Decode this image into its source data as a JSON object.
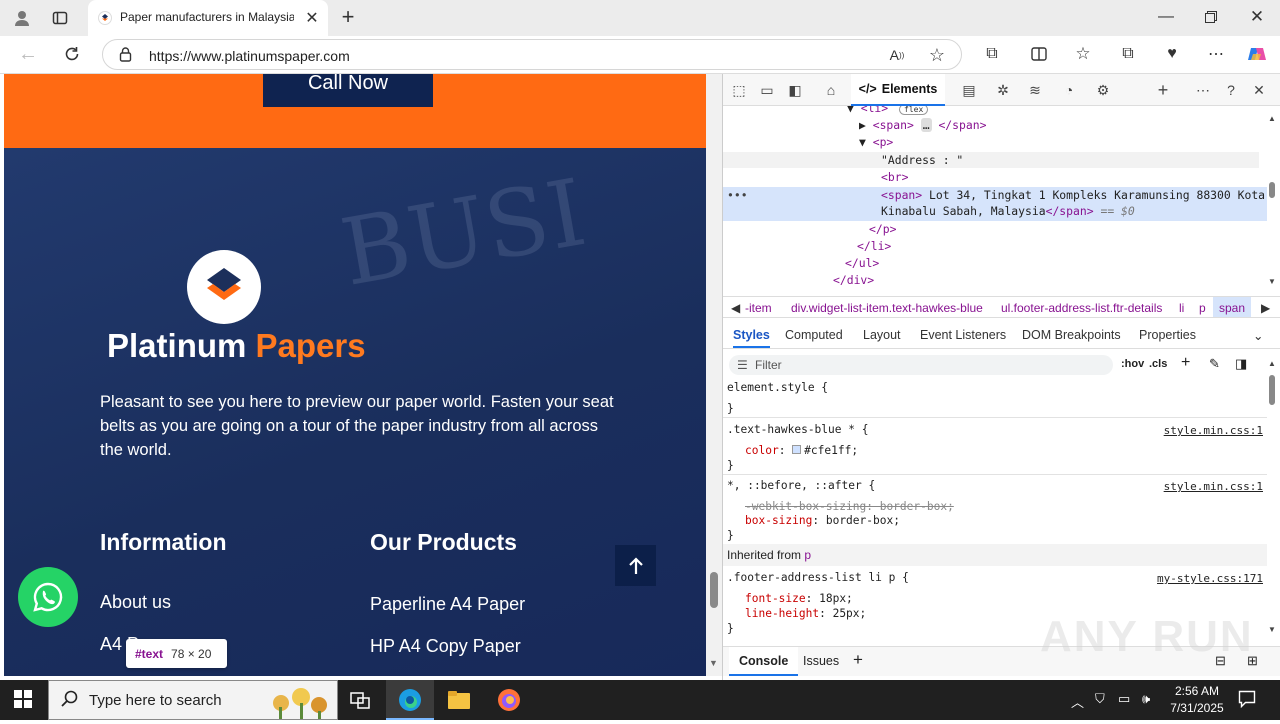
{
  "browser": {
    "tab_title": "Paper manufacturers in Malaysia,",
    "url": "https://www.platinumspaper.com"
  },
  "page": {
    "call_button": "Call Now",
    "brand_part1": "Platinum",
    "brand_part2": "Papers",
    "tagline": "Pleasant to see you here to preview our paper world. Fasten your seat belts as you are going on a tour of the paper industry from all across the world.",
    "info_heading": "Information",
    "info_links": [
      "About us",
      "A4 P"
    ],
    "products_heading": "Our Products",
    "product_links": [
      "Paperline A4 Paper",
      "HP A4 Copy Paper"
    ],
    "newspaper_word": "BUSI",
    "tooltip_node": "#text",
    "tooltip_size": "78 × 20",
    "colors": {
      "orange": "#ff6a13",
      "navy": "#1c2f5b",
      "whatsapp": "#25d366"
    }
  },
  "devtools": {
    "elements_tab": "Elements",
    "tree": {
      "li_open": "<li>",
      "flex_badge": "flex",
      "span_collapsed": "<span>",
      "span_close": "</span>",
      "p_open": "<p>",
      "address_text": "\"Address : \"",
      "br": "<br>",
      "span_open": "<span>",
      "span_text": " Lot 34, Tingkat 1 Kompleks Karamunsing 88300 Kota",
      "span_text2": "Kinabalu Sabah, Malaysia",
      "span_end": "</span>",
      "eq_dollar": " == $0",
      "p_close": "</p>",
      "li_close": "</li>",
      "ul_close": "</ul>",
      "div_close": "</div>",
      "dots": "•••"
    },
    "breadcrumbs": [
      "-item",
      "div.widget-list-item.text-hawkes-blue",
      "ul.footer-address-list.ftr-details",
      "li",
      "p",
      "span"
    ],
    "subtabs": [
      "Styles",
      "Computed",
      "Layout",
      "Event Listeners",
      "DOM Breakpoints",
      "Properties"
    ],
    "filter_placeholder": "Filter",
    "hov": ":hov",
    "cls": ".cls",
    "rules": {
      "r1_selector": "element.style {",
      "r1_close": "}",
      "r2_selector": ".text-hawkes-blue * {",
      "r2_prop": "color",
      "r2_value": "#cfe1ff;",
      "r2_source": "style.min.css:1",
      "r2_close": "}",
      "r3_selector": "*, ::before, ::after {",
      "r3_source": "style.min.css:1",
      "r3_prop1": "-webkit-box-sizing: border-box;",
      "r3_prop2": "box-sizing",
      "r3_value2": "border-box;",
      "r3_close": "}",
      "inherited_label": "Inherited from",
      "inherited_tag": "p",
      "r4_selector": ".footer-address-list li p {",
      "r4_source": "my-style.css:171",
      "r4_prop1": "font-size",
      "r4_value1": "18px;",
      "r4_prop2": "line-height",
      "r4_value2": "25px;",
      "r4_close": "}"
    },
    "console_tab": "Console",
    "issues_tab": "Issues"
  },
  "taskbar": {
    "search_placeholder": "Type here to search",
    "time": "2:56 AM",
    "date": "7/31/2025"
  },
  "watermark": "ANY RUN"
}
